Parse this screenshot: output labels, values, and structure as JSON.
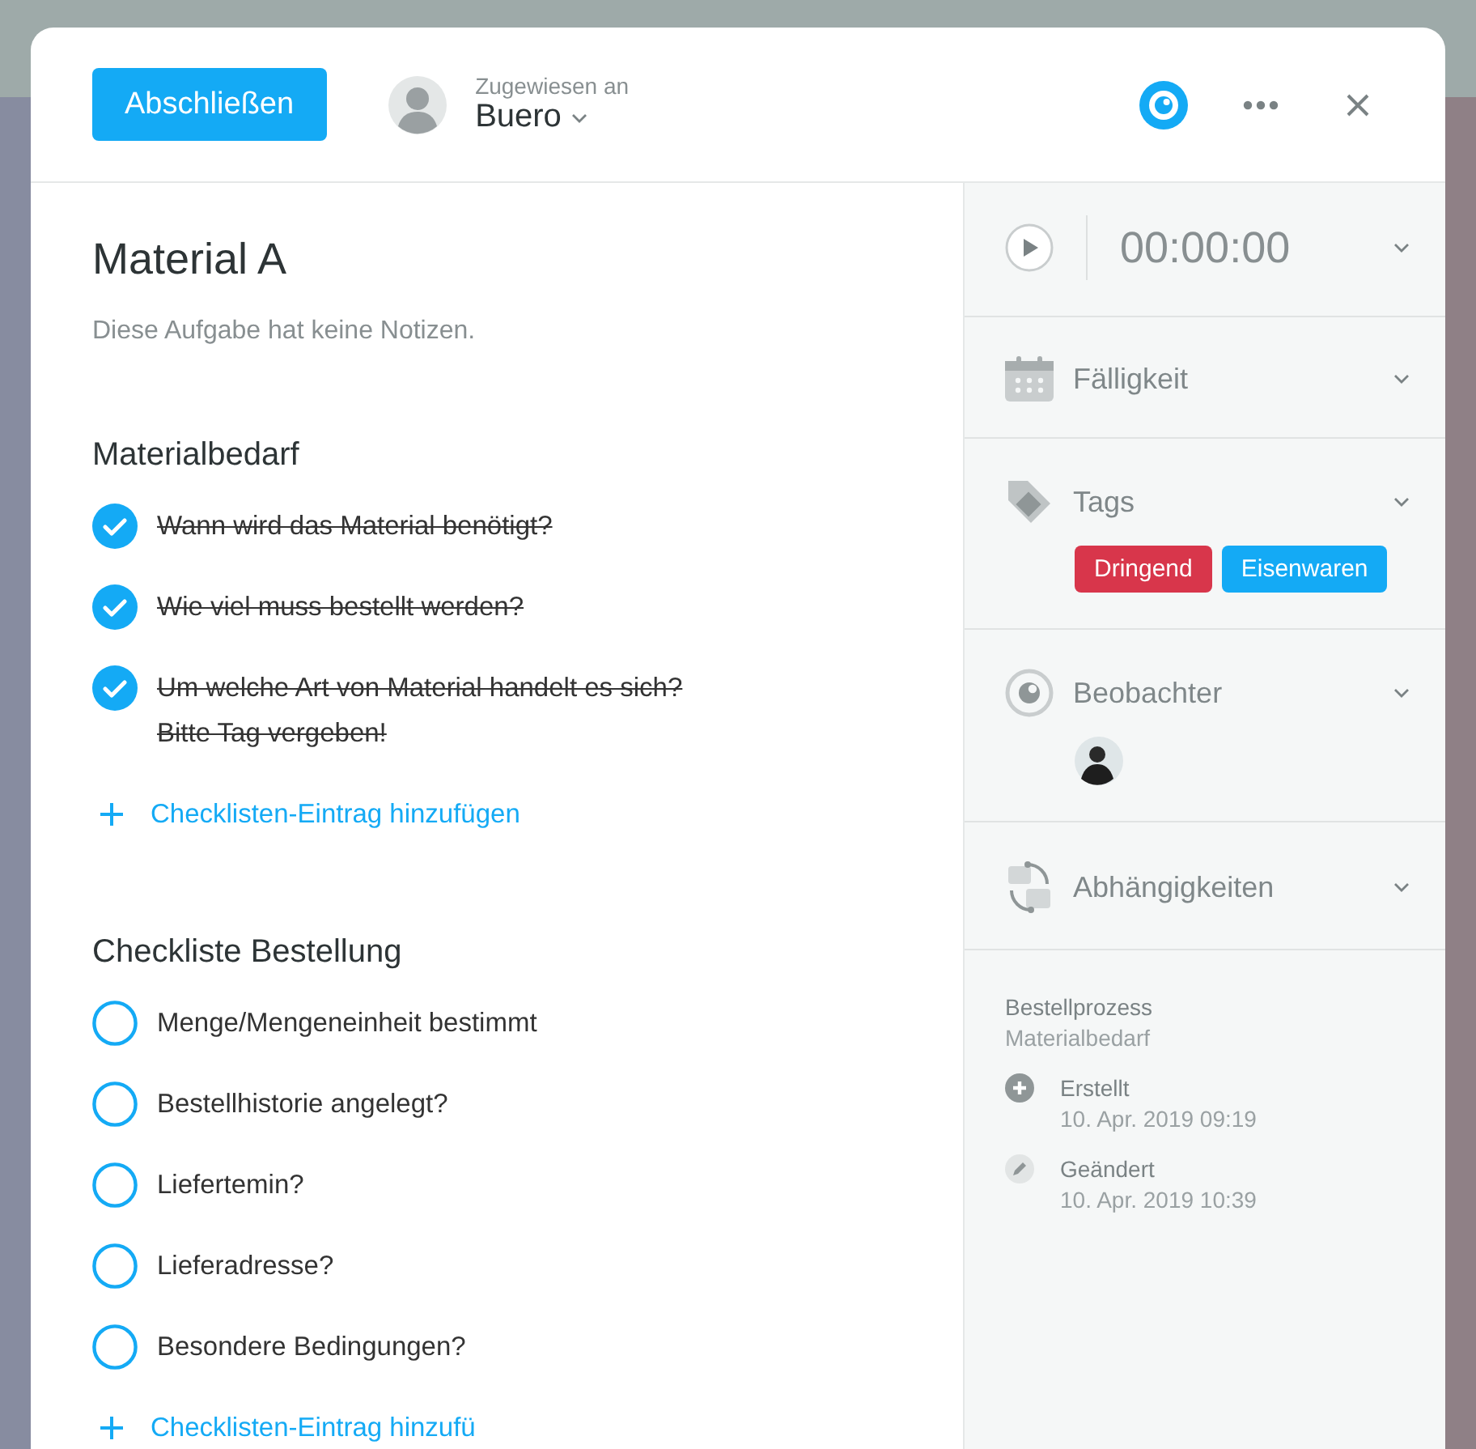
{
  "header": {
    "complete_button": "Abschließen",
    "assignee": {
      "label": "Zugewiesen an",
      "name": "Buero"
    },
    "watching": true
  },
  "task": {
    "title": "Material A",
    "notes": "Diese Aufgabe hat keine Notizen."
  },
  "checklists": [
    {
      "title": "Materialbedarf",
      "items": [
        {
          "text": "Wann wird das Material benötigt?",
          "checked": true
        },
        {
          "text": "Wie viel muss bestellt werden?",
          "checked": true
        },
        {
          "text": "Um welche Art von Material handelt es sich? Bitte Tag vergeben!",
          "checked": true
        }
      ],
      "add_label": "Checklisten-Eintrag hinzufügen"
    },
    {
      "title": "Checkliste Bestellung",
      "items": [
        {
          "text": "Menge/Mengeneinheit bestimmt",
          "checked": false
        },
        {
          "text": "Bestellhistorie angelegt?",
          "checked": false
        },
        {
          "text": "Liefertemin?",
          "checked": false
        },
        {
          "text": "Lieferadresse?",
          "checked": false
        },
        {
          "text": "Besondere Bedingungen?",
          "checked": false
        }
      ],
      "add_label": "Checklisten-Eintrag hinzufü"
    }
  ],
  "sidebar": {
    "timer": {
      "time": "00:00:00"
    },
    "sections": [
      {
        "kind": "due",
        "label": "Fälligkeit"
      },
      {
        "kind": "tags",
        "label": "Tags",
        "tags": [
          {
            "label": "Dringend",
            "color": "#d8364b"
          },
          {
            "label": "Eisenwaren",
            "color": "#14aaf5"
          }
        ]
      },
      {
        "kind": "watchers",
        "label": "Beobachter",
        "watchers": [
          {
            "kind": "avatar"
          }
        ]
      },
      {
        "kind": "dependencies",
        "label": "Abhängigkeiten"
      }
    ],
    "meta": {
      "process": "Bestellprozess",
      "step": "Materialbedarf",
      "events": [
        {
          "kind": "created",
          "label": "Erstellt",
          "date": "10. Apr. 2019 09:19"
        },
        {
          "kind": "changed",
          "label": "Geändert",
          "date": "10. Apr. 2019 10:39"
        }
      ]
    }
  }
}
